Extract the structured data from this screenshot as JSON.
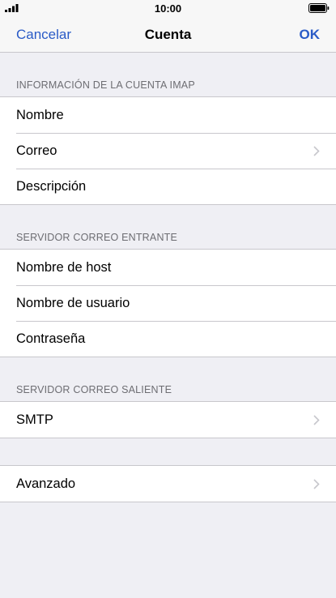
{
  "status": {
    "time": "10:00",
    "signal_icon": "cellular-signal-icon",
    "battery_icon": "battery-icon"
  },
  "nav": {
    "cancel_label": "Cancelar",
    "title": "Cuenta",
    "ok_label": "OK"
  },
  "sections": [
    {
      "header": "INFORMACIÓN DE LA CUENTA IMAP",
      "rows": [
        {
          "label": "Nombre",
          "chevron": false
        },
        {
          "label": "Correo",
          "chevron": true
        },
        {
          "label": "Descripción",
          "chevron": false
        }
      ]
    },
    {
      "header": "SERVIDOR CORREO ENTRANTE",
      "rows": [
        {
          "label": "Nombre de host",
          "chevron": false
        },
        {
          "label": "Nombre de usuario",
          "chevron": false
        },
        {
          "label": "Contraseña",
          "chevron": false
        }
      ]
    },
    {
      "header": "SERVIDOR CORREO SALIENTE",
      "rows": [
        {
          "label": "SMTP",
          "chevron": true
        }
      ]
    },
    {
      "header": "",
      "rows": [
        {
          "label": "Avanzado",
          "chevron": true
        }
      ]
    }
  ],
  "colors": {
    "accent": "#2a5bc7",
    "background": "#efeff4",
    "separator": "#c8c7cc",
    "header_text": "#6d6d72"
  }
}
